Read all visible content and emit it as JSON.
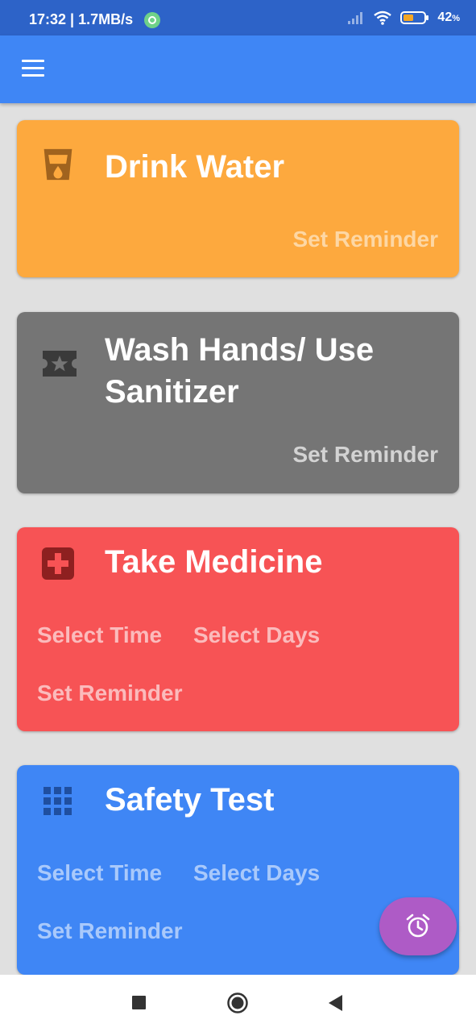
{
  "status_bar": {
    "time_speed": "17:32 | 1.7MB/s",
    "battery": "42",
    "battery_unit": "%",
    "icons": [
      "whatsapp-icon",
      "signal-icon",
      "wifi-icon",
      "battery-icon"
    ]
  },
  "app_bar": {
    "menu_icon": "hamburger-menu-icon"
  },
  "cards": [
    {
      "title": "Drink Water",
      "icon": "water-glass-icon",
      "color": "#fda93e",
      "actions": [
        "Set Reminder"
      ]
    },
    {
      "title": "Wash Hands/ Use Sanitizer",
      "icon": "ticket-star-icon",
      "color": "#757575",
      "actions": [
        "Set Reminder"
      ]
    },
    {
      "title": "Take Medicine",
      "icon": "medical-cross-icon",
      "color": "#f75355",
      "actions": [
        "Select Time",
        "Select Days",
        "Set Reminder"
      ]
    },
    {
      "title": "Safety Test",
      "icon": "grid-dots-icon",
      "color": "#3f86f5",
      "actions": [
        "Select Time",
        "Select Days",
        "Set Reminder"
      ]
    }
  ],
  "fab": {
    "icon": "alarm-clock-icon",
    "color": "#ae5bc6"
  },
  "nav_bar": {
    "icons": [
      "recent-apps-icon",
      "home-icon",
      "back-icon"
    ]
  }
}
